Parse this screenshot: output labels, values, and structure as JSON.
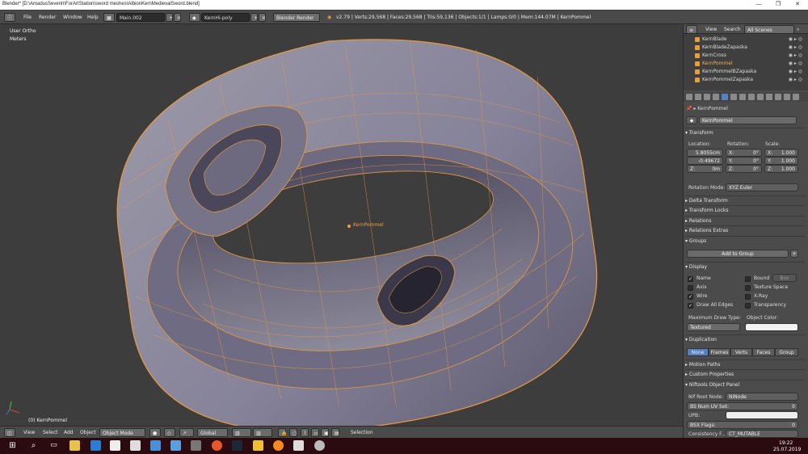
{
  "window": {
    "title": "Blender* [D:\\AmadusSeverin\\ForArtStation\\sword meshes\\AlbionKernMedievalSword.blend]",
    "minimize": "—",
    "maximize": "❐",
    "close": "✕"
  },
  "infobar": {
    "menu": [
      "File",
      "Render",
      "Window",
      "Help"
    ],
    "screen": "Main.002",
    "scene": "KernHi-poly",
    "engine": "Blender Render",
    "stats": "v2.79 | Verts:29,568 | Faces:29,568 | Tris:59,136 | Objects:1/1 | Lamps:0/0 | Mem:144.07M | KernPommel"
  },
  "viewport": {
    "view_name": "User Ortho",
    "units": "Meters",
    "object_label": "KernPommel",
    "status": "(0) KernPommel",
    "mesh_body": "#8a8797",
    "mesh_shadow": "#5a5869",
    "wire_color": "#f0a040",
    "bg": "#3d3d3d"
  },
  "vpheader": {
    "menu": [
      "View",
      "Select",
      "Add",
      "Object"
    ],
    "mode": "Object Mode",
    "orientation": "Global",
    "selection": "Selection"
  },
  "outliner": {
    "view": "View",
    "search": "Search",
    "filter": "All Scenes",
    "items": [
      {
        "name": "KernBlade"
      },
      {
        "name": "KernBladeZapaska"
      },
      {
        "name": "KernCross"
      },
      {
        "name": "KernPommel",
        "active": true
      },
      {
        "name": "KernPommelBZapaska"
      },
      {
        "name": "KernPommelZapaska"
      }
    ]
  },
  "props": {
    "breadcrumb": "KernPommel",
    "object_name": "KernPommel",
    "transform": {
      "header": "Transform",
      "location_label": "Location:",
      "rotation_label": "Rotation:",
      "scale_label": "Scale:",
      "loc": [
        "5.8055cm",
        "-0.49672",
        "0m"
      ],
      "rot": [
        "0°",
        "0°",
        "0°"
      ],
      "scale": [
        "1.000",
        "1.000",
        "1.000"
      ],
      "axes": [
        "X:",
        "Y:",
        "Z:"
      ],
      "rotation_mode_label": "Rotation Mode:",
      "rotation_mode": "XYZ Euler"
    },
    "panels_collapsed": [
      "Delta Transform",
      "Transform Locks",
      "Relations",
      "Relations Extras"
    ],
    "groups": {
      "header": "Groups",
      "add": "Add to Group"
    },
    "display": {
      "header": "Display",
      "left": [
        {
          "label": "Name",
          "checked": true
        },
        {
          "label": "Axis",
          "checked": false
        },
        {
          "label": "Wire",
          "checked": true
        },
        {
          "label": "Draw All Edges",
          "checked": true
        }
      ],
      "right": [
        {
          "label": "Bound",
          "checked": false
        },
        {
          "label": "Texture Space",
          "checked": false
        },
        {
          "label": "X-Ray",
          "checked": false
        },
        {
          "label": "Transparency",
          "checked": false
        }
      ],
      "bound_type": "Box",
      "max_draw_label": "Maximum Draw Type:",
      "max_draw": "Textured",
      "color_label": "Object Color:"
    },
    "duplication": {
      "header": "Duplication",
      "options": [
        "None",
        "Frames",
        "Verts",
        "Faces",
        "Group"
      ],
      "selected": "None"
    },
    "motion_paths": "Motion Paths",
    "custom_props": "Custom Properties",
    "niftools": {
      "header": "Niftools Object Panel",
      "root_label": "Nif Root Node:",
      "root": "NiNode",
      "bs_uv": "BS Num UV Set:",
      "bs_uv_val": "0",
      "upb": "UPB:",
      "bsx": "BSX Flags:",
      "bsx_val": "0",
      "consistency": "Consistency F...",
      "consistency_val": "CT_MUTABLE"
    }
  },
  "taskbar": {
    "time": "19:22",
    "date": "25.07.2019"
  }
}
